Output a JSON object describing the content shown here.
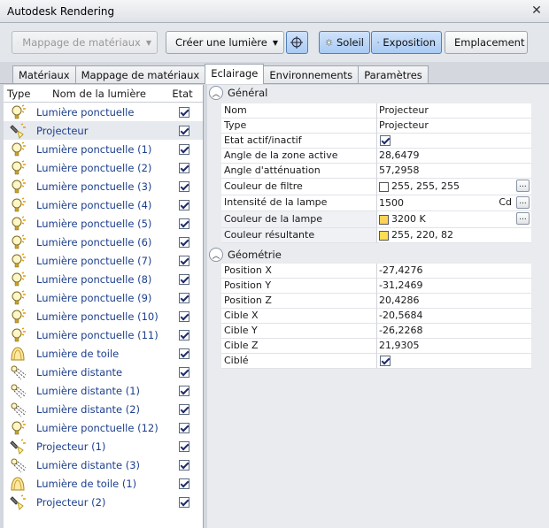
{
  "window": {
    "title": "Autodesk Rendering"
  },
  "toolbar": {
    "mapping_label": "Mappage de matériaux",
    "create_light_label": "Créer une lumière",
    "sun_label": "Soleil",
    "exposure_label": "Exposition",
    "location_label": "Emplacement"
  },
  "tabs": [
    "Matériaux",
    "Mappage de matériaux",
    "Eclairage",
    "Environnements",
    "Paramètres"
  ],
  "list": {
    "headers": {
      "type": "Type",
      "name": "Nom de la lumière",
      "state": "Etat"
    },
    "items": [
      {
        "name": "Lumière ponctuelle",
        "icon": "point-light"
      },
      {
        "name": "Projecteur",
        "icon": "spot-light"
      },
      {
        "name": "Lumière ponctuelle (1)",
        "icon": "point-light"
      },
      {
        "name": "Lumière ponctuelle (2)",
        "icon": "point-light"
      },
      {
        "name": "Lumière ponctuelle (3)",
        "icon": "point-light"
      },
      {
        "name": "Lumière ponctuelle (4)",
        "icon": "point-light"
      },
      {
        "name": "Lumière ponctuelle (5)",
        "icon": "point-light"
      },
      {
        "name": "Lumière ponctuelle (6)",
        "icon": "point-light"
      },
      {
        "name": "Lumière ponctuelle (7)",
        "icon": "point-light"
      },
      {
        "name": "Lumière ponctuelle (8)",
        "icon": "point-light"
      },
      {
        "name": "Lumière ponctuelle (9)",
        "icon": "point-light"
      },
      {
        "name": "Lumière ponctuelle (10)",
        "icon": "point-light"
      },
      {
        "name": "Lumière ponctuelle (11)",
        "icon": "point-light"
      },
      {
        "name": "Lumière de toile",
        "icon": "web-light"
      },
      {
        "name": "Lumière distante",
        "icon": "distant-light"
      },
      {
        "name": "Lumière distante (1)",
        "icon": "distant-light"
      },
      {
        "name": "Lumière distante (2)",
        "icon": "distant-light"
      },
      {
        "name": "Lumière ponctuelle (12)",
        "icon": "point-light"
      },
      {
        "name": "Projecteur (1)",
        "icon": "spot-light"
      },
      {
        "name": "Lumière distante (3)",
        "icon": "distant-light"
      },
      {
        "name": "Lumière de toile (1)",
        "icon": "web-light"
      },
      {
        "name": "Projecteur (2)",
        "icon": "spot-light"
      }
    ]
  },
  "general": {
    "title": "Général",
    "name_label": "Nom",
    "name_value": "Projecteur",
    "type_label": "Type",
    "type_value": "Projecteur",
    "state_label": "Etat actif/inactif",
    "hotspot_label": "Angle de la zone active",
    "hotspot_value": "28,6479",
    "falloff_label": "Angle d'atténuation",
    "falloff_value": "57,2958",
    "filter_label": "Couleur de filtre",
    "filter_value": "255, 255, 255",
    "filter_color": "#ffffff",
    "intensity_label": "Intensité de la lampe",
    "intensity_value": "1500",
    "intensity_unit": "Cd",
    "lamp_color_label": "Couleur de la lampe",
    "lamp_color_value": "3200 K",
    "lamp_color": "#ffd35a",
    "result_color_label": "Couleur résultante",
    "result_color_value": "255, 220, 82",
    "result_color": "#ffdc52"
  },
  "geometry": {
    "title": "Géométrie",
    "px_label": "Position X",
    "px_value": "-27,4276",
    "py_label": "Position Y",
    "py_value": "-31,2469",
    "pz_label": "Position Z",
    "pz_value": "20,4286",
    "tx_label": "Cible X",
    "tx_value": "-20,5684",
    "ty_label": "Cible Y",
    "ty_value": "-26,2268",
    "tz_label": "Cible Z",
    "tz_value": "21,9305",
    "targeted_label": "Ciblé"
  }
}
